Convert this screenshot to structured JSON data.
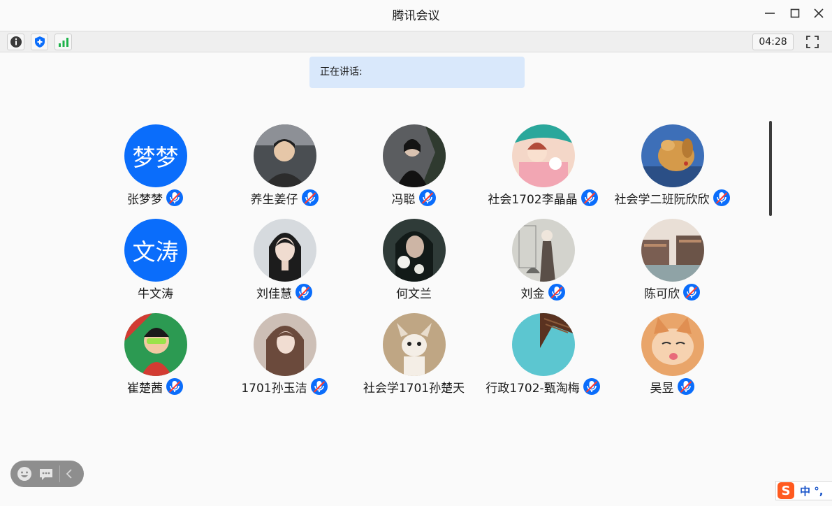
{
  "window": {
    "title": "腾讯会议"
  },
  "toolbar": {
    "timer": "04:28"
  },
  "speaking": {
    "label": "正在讲话:"
  },
  "participants": [
    {
      "name": "张梦梦",
      "avatar_text": "梦梦",
      "mic_icon": "mic-icon",
      "avatar_kind": "text"
    },
    {
      "name": "养生姜仔",
      "avatar_icon": "person-photo",
      "mic_icon": "mic-icon"
    },
    {
      "name": "冯聪",
      "avatar_icon": "person-photo",
      "mic_icon": "mic-icon"
    },
    {
      "name": "社会1702李晶晶",
      "avatar_icon": "cartoon-girl",
      "mic_icon": "mic-icon"
    },
    {
      "name": "社会学二班阮欣欣",
      "avatar_icon": "dog-photo",
      "mic_icon": "mic-icon"
    },
    {
      "name": "牛文涛",
      "avatar_text": "文涛",
      "avatar_kind": "text"
    },
    {
      "name": "刘佳慧",
      "avatar_icon": "person-photo",
      "mic_icon": "mic-icon"
    },
    {
      "name": "何文兰",
      "avatar_icon": "person-photo"
    },
    {
      "name": "刘金",
      "avatar_icon": "sketch-girl",
      "mic_icon": "mic-icon"
    },
    {
      "name": "陈可欣",
      "avatar_icon": "city-photo",
      "mic_icon": "mic-icon"
    },
    {
      "name": "崔楚茜",
      "avatar_icon": "cartoon-boy",
      "mic_icon": "mic-icon"
    },
    {
      "name": "1701孙玉洁",
      "avatar_icon": "person-photo",
      "mic_icon": "mic-icon"
    },
    {
      "name": "社会学1701孙楚天",
      "avatar_icon": "chihuahua-photo",
      "mic_icon": "mic-icon"
    },
    {
      "name": "行政1702-甄淘梅",
      "avatar_icon": "abstract-image",
      "mic_icon": "mic-icon"
    },
    {
      "name": "吴昱",
      "avatar_icon": "cat-photo",
      "mic_icon": "mic-icon"
    }
  ],
  "ime": {
    "logo": "S",
    "text": "中 °,"
  },
  "colors": {
    "accent": "#0a6dfb",
    "banner": "#d9e8fb",
    "signal": "#1fb34b"
  }
}
